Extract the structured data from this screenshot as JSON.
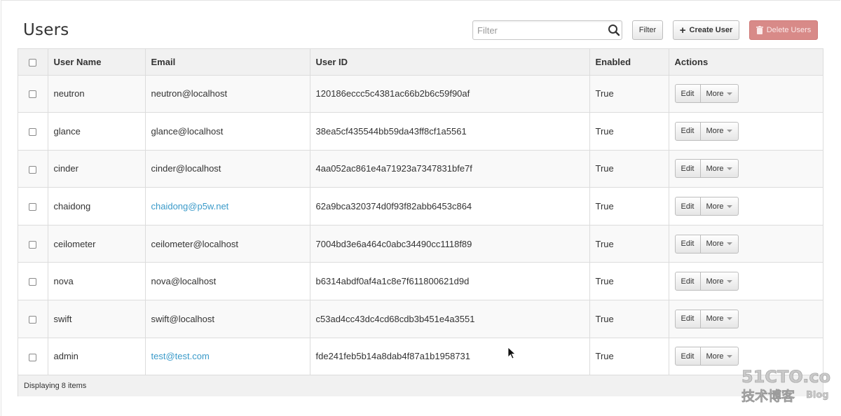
{
  "page": {
    "title": "Users"
  },
  "toolbar": {
    "filter_placeholder": "Filter",
    "filter_button": "Filter",
    "create_button": "Create User",
    "delete_button": "Delete Users"
  },
  "table": {
    "columns": [
      "User Name",
      "Email",
      "User ID",
      "Enabled",
      "Actions"
    ],
    "rows": [
      {
        "name": "neutron",
        "email": "neutron@localhost",
        "email_link": false,
        "id": "120186eccc5c4381ac66b2b6c59f90af",
        "enabled": "True"
      },
      {
        "name": "glance",
        "email": "glance@localhost",
        "email_link": false,
        "id": "38ea5cf435544bb59da43ff8cf1a5561",
        "enabled": "True"
      },
      {
        "name": "cinder",
        "email": "cinder@localhost",
        "email_link": false,
        "id": "4aa052ac861e4a71923a7347831bfe7f",
        "enabled": "True"
      },
      {
        "name": "chaidong",
        "email": "chaidong@p5w.net",
        "email_link": true,
        "id": "62a9bca320374d0f93f82abb6453c864",
        "enabled": "True"
      },
      {
        "name": "ceilometer",
        "email": "ceilometer@localhost",
        "email_link": false,
        "id": "7004bd3e6a464c0abc34490cc1118f89",
        "enabled": "True"
      },
      {
        "name": "nova",
        "email": "nova@localhost",
        "email_link": false,
        "id": "b6314abdf0af4a1c8e7f611800621d9d",
        "enabled": "True"
      },
      {
        "name": "swift",
        "email": "swift@localhost",
        "email_link": false,
        "id": "c53ad4cc43dc4cd68cdb3b451e4a3551",
        "enabled": "True"
      },
      {
        "name": "admin",
        "email": "test@test.com",
        "email_link": true,
        "id": "fde241feb5b14a8dab4f87a1b1958731",
        "enabled": "True"
      }
    ],
    "edit_label": "Edit",
    "more_label": "More",
    "footer": "Displaying 8 items"
  },
  "watermark": {
    "line1": "51CTO.com",
    "line2": "技术博客",
    "line3": "Blog"
  },
  "colors": {
    "link": "#3a9ac9",
    "danger": "#d88a88"
  }
}
